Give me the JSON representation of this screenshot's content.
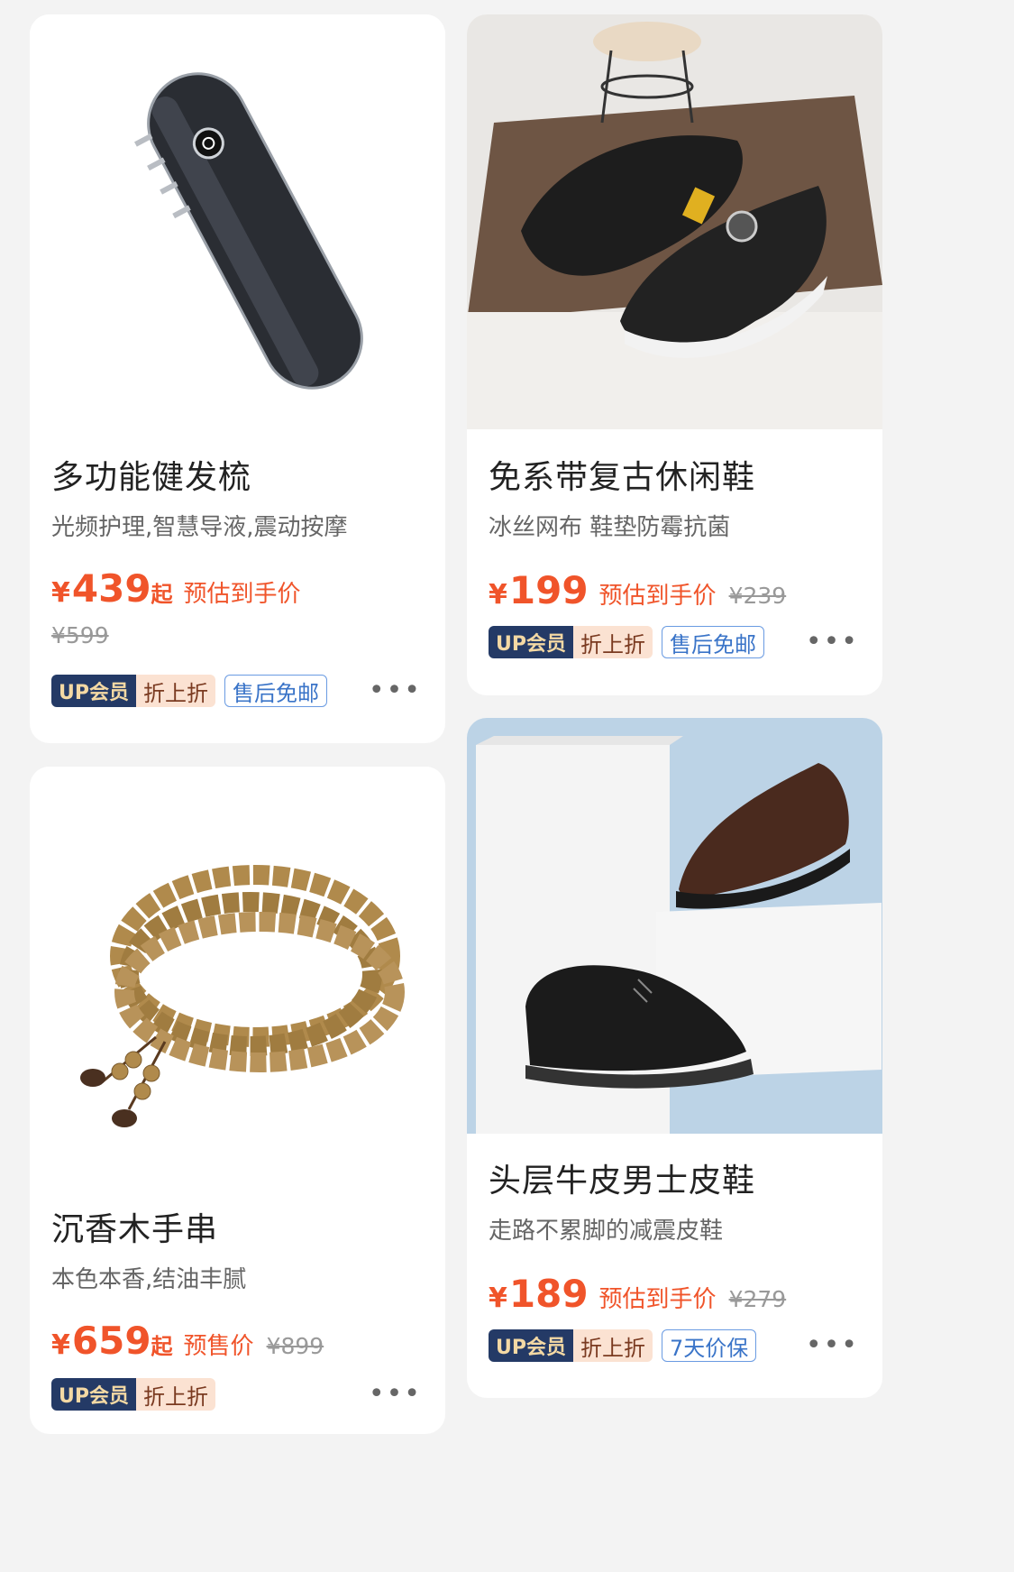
{
  "products": [
    {
      "title": "多功能健发梳",
      "subtitle": "光频护理,智慧导液,震动按摩",
      "currency": "¥",
      "price": "439",
      "price_suffix": "起",
      "price_label": "预估到手价",
      "original_price": "¥599",
      "vip_badge": "UP会员",
      "vip_discount": "折上折",
      "service_tag": "售后免邮",
      "more": "•••"
    },
    {
      "title": "免系带复古休闲鞋",
      "subtitle": " 冰丝网布 鞋垫防霉抗菌",
      "currency": "¥",
      "price": "199",
      "price_label": "预估到手价",
      "original_price": "¥239",
      "vip_badge": "UP会员",
      "vip_discount": "折上折",
      "service_tag": "售后免邮",
      "more": "•••"
    },
    {
      "title": "沉香木手串",
      "subtitle": "本色本香,结油丰腻",
      "currency": "¥",
      "price": "659",
      "price_suffix": "起",
      "price_label": "预售价",
      "original_price": "¥899",
      "vip_badge": "UP会员",
      "vip_discount": "折上折",
      "more": "•••"
    },
    {
      "title": "头层牛皮男士皮鞋",
      "subtitle": "走路不累脚的减震皮鞋",
      "currency": "¥",
      "price": "189",
      "price_label": "预估到手价",
      "original_price": "¥279",
      "vip_badge": "UP会员",
      "vip_discount": "折上折",
      "service_tag": "7天价保",
      "more": "•••"
    }
  ],
  "colors": {
    "price": "#f0542a",
    "vip_dark": "#243a66",
    "vip_gold": "#f4d9a4",
    "service_blue": "#3a74c8",
    "page_bg": "#f3f3f3"
  }
}
